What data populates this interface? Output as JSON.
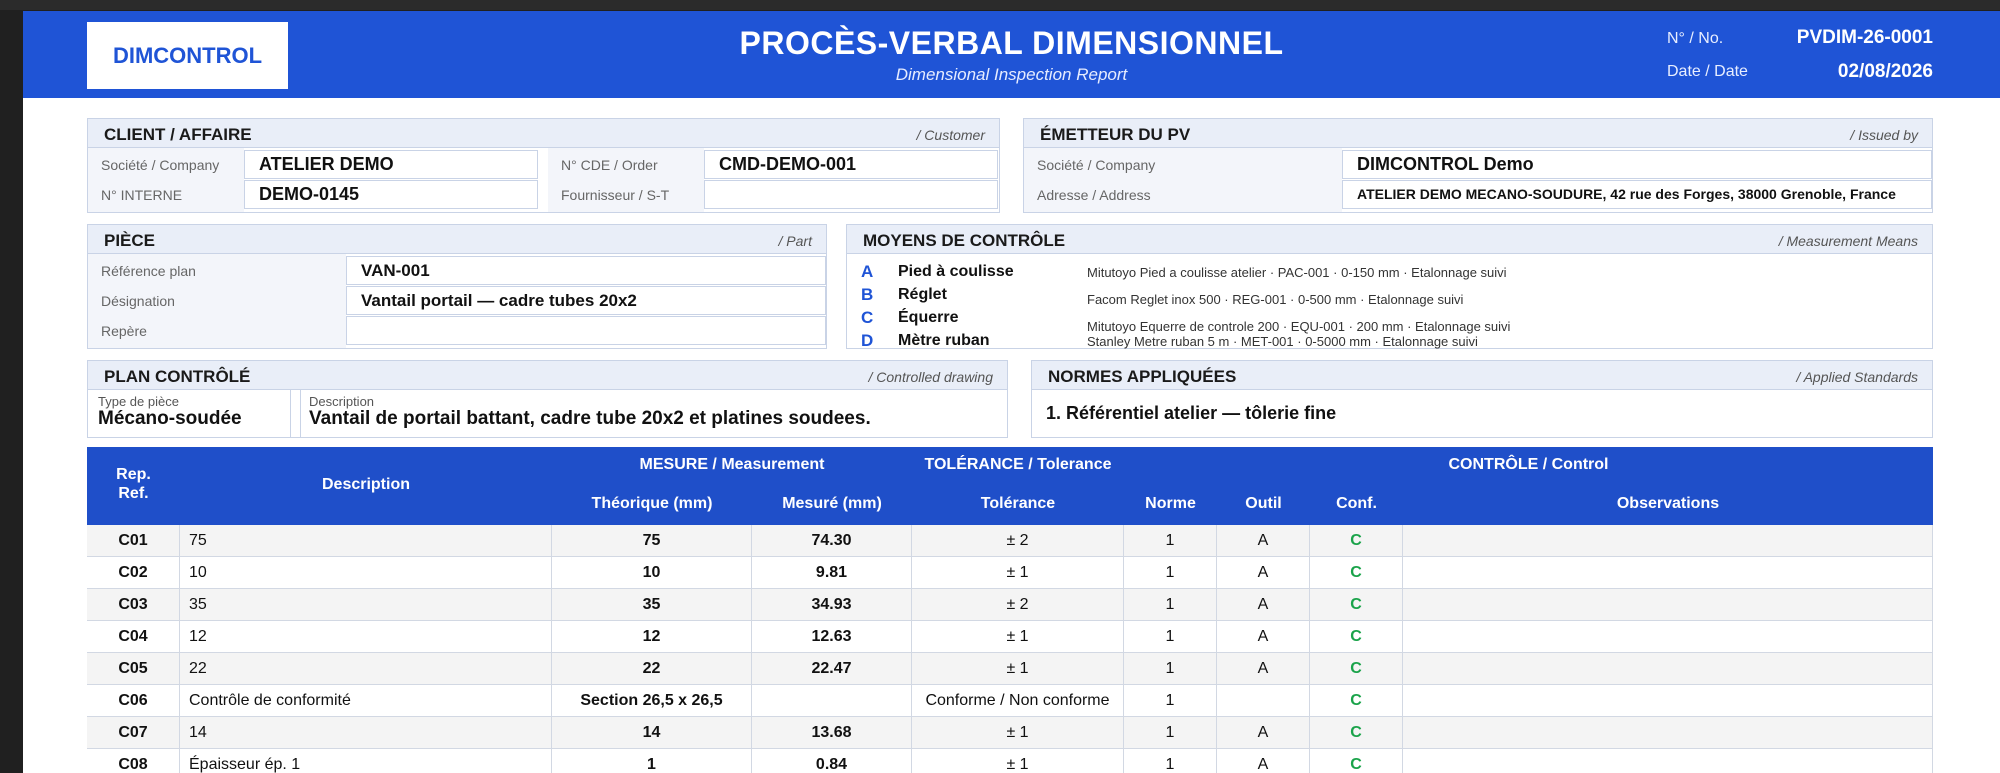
{
  "header": {
    "logo": "DIMCONTROL",
    "title": "PROCÈS-VERBAL DIMENSIONNEL",
    "subtitle": "Dimensional Inspection Report",
    "no_label": "N° / No.",
    "no_value": "PVDIM-26-0001",
    "date_label": "Date / Date",
    "date_value": "02/08/2026"
  },
  "client": {
    "title": "CLIENT / AFFAIRE",
    "title_en": "/ Customer",
    "company_label": "Société / Company",
    "company_value": "ATELIER DEMO",
    "order_label": "N° CDE / Order",
    "order_value": "CMD-DEMO-001",
    "internal_label": "N° INTERNE",
    "internal_value": "DEMO-0145",
    "supplier_label": "Fournisseur / S-T",
    "supplier_value": ""
  },
  "issuer": {
    "title": "ÉMETTEUR DU PV",
    "title_en": "/ Issued by",
    "company_label": "Société / Company",
    "company_value": "DIMCONTROL Demo",
    "address_label": "Adresse / Address",
    "address_value": "ATELIER DEMO MECANO-SOUDURE, 42 rue des Forges, 38000 Grenoble, France"
  },
  "part": {
    "title": "PIÈCE",
    "title_en": "/ Part",
    "ref_label": "Référence plan",
    "ref_value": "VAN-001",
    "desig_label": "Désignation",
    "desig_value": "Vantail portail — cadre tubes 20x2",
    "mark_label": "Repère",
    "mark_value": ""
  },
  "means": {
    "title": "MOYENS DE CONTRÔLE",
    "title_en": "/ Measurement Means",
    "items": [
      {
        "letter": "A",
        "name": "Pied à coulisse",
        "detail": "Mitutoyo Pied a coulisse atelier  ·  PAC-001  ·  0-150 mm  ·  Etalonnage suivi"
      },
      {
        "letter": "B",
        "name": "Réglet",
        "detail": "Facom Reglet inox 500  ·  REG-001  ·  0-500 mm  ·  Etalonnage suivi"
      },
      {
        "letter": "C",
        "name": "Équerre",
        "detail": "Mitutoyo Equerre de controle 200  ·  EQU-001  ·  200 mm  ·  Etalonnage suivi"
      },
      {
        "letter": "D",
        "name": "Mètre ruban",
        "detail": "Stanley Metre ruban 5 m  ·  MET-001  ·  0-5000 mm  ·  Etalonnage suivi"
      }
    ]
  },
  "plan": {
    "title": "PLAN CONTRÔLÉ",
    "title_en": "/ Controlled drawing",
    "type_label": "Type de pièce",
    "type_value": "Mécano-soudée",
    "desc_label": "Description",
    "desc_value": "Vantail de portail battant, cadre tube 20x2 et platines soudees."
  },
  "standards": {
    "title": "NORMES APPLIQUÉES",
    "title_en": "/ Applied Standards",
    "item": "1.  Référentiel atelier — tôlerie fine"
  },
  "table": {
    "h_rep": "Rep.",
    "h_ref": "Ref.",
    "h_desc": "Description",
    "h_measure": "MESURE / Measurement",
    "h_theo": "Théorique (mm)",
    "h_meas": "Mesuré (mm)",
    "h_tol_group": "TOLÉRANCE / Tolerance",
    "h_tol": "Tolérance",
    "h_control": "CONTRÔLE / Control",
    "h_norm": "Norme",
    "h_tool": "Outil",
    "h_conf": "Conf.",
    "h_obs": "Observations",
    "rows": [
      {
        "ref": "C01",
        "desc": "75",
        "theo": "75",
        "meas": "74.30",
        "tol": "± 2",
        "norm": "1",
        "tool": "A",
        "conf": "C",
        "obs": ""
      },
      {
        "ref": "C02",
        "desc": "10",
        "theo": "10",
        "meas": "9.81",
        "tol": "± 1",
        "norm": "1",
        "tool": "A",
        "conf": "C",
        "obs": ""
      },
      {
        "ref": "C03",
        "desc": "35",
        "theo": "35",
        "meas": "34.93",
        "tol": "± 2",
        "norm": "1",
        "tool": "A",
        "conf": "C",
        "obs": ""
      },
      {
        "ref": "C04",
        "desc": "12",
        "theo": "12",
        "meas": "12.63",
        "tol": "± 1",
        "norm": "1",
        "tool": "A",
        "conf": "C",
        "obs": ""
      },
      {
        "ref": "C05",
        "desc": "22",
        "theo": "22",
        "meas": "22.47",
        "tol": "± 1",
        "norm": "1",
        "tool": "A",
        "conf": "C",
        "obs": ""
      },
      {
        "ref": "C06",
        "desc": "Contrôle de conformité",
        "theo": "Section 26,5 x 26,5",
        "meas": "",
        "tol": "Conforme / Non conforme",
        "norm": "1",
        "tool": "",
        "conf": "C",
        "obs": ""
      },
      {
        "ref": "C07",
        "desc": "14",
        "theo": "14",
        "meas": "13.68",
        "tol": "± 1",
        "norm": "1",
        "tool": "A",
        "conf": "C",
        "obs": ""
      },
      {
        "ref": "C08",
        "desc": "Épaisseur ép. 1",
        "theo": "1",
        "meas": "0.84",
        "tol": "± 1",
        "norm": "1",
        "tool": "A",
        "conf": "C",
        "obs": ""
      }
    ]
  },
  "colors": {
    "brand": "#1f54d6",
    "table_header": "#1f4fc9",
    "conform": "#1aa34a"
  }
}
